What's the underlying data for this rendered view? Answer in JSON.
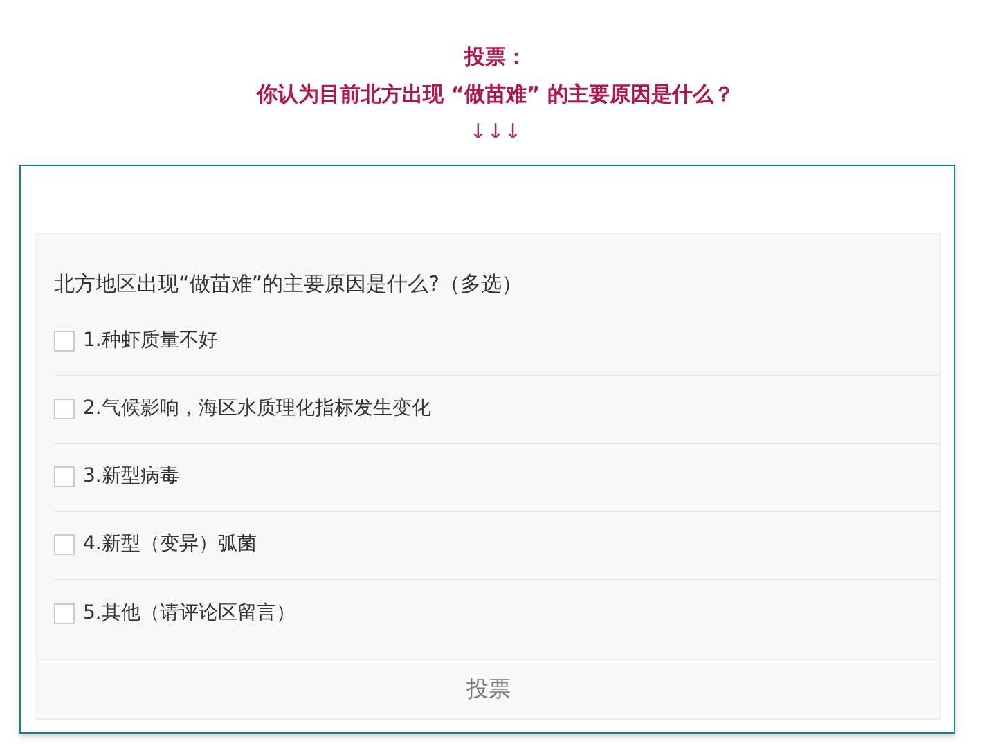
{
  "header": {
    "title": "投票：",
    "question": "你认为目前北方出现 “做苗难” 的主要原因是什么？",
    "arrows": "↓↓↓"
  },
  "poll": {
    "question": "北方地区出现“做苗难”的主要原因是什么?（多选）",
    "options": [
      {
        "label": "1.种虾质量不好",
        "checked": false
      },
      {
        "label": "2.气候影响，海区水质理化指标发生变化",
        "checked": false
      },
      {
        "label": "3.新型病毒",
        "checked": false
      },
      {
        "label": "4.新型（变异）弧菌",
        "checked": false
      },
      {
        "label": "5.其他（请评论区留言）",
        "checked": false
      }
    ],
    "submit": "投票"
  }
}
